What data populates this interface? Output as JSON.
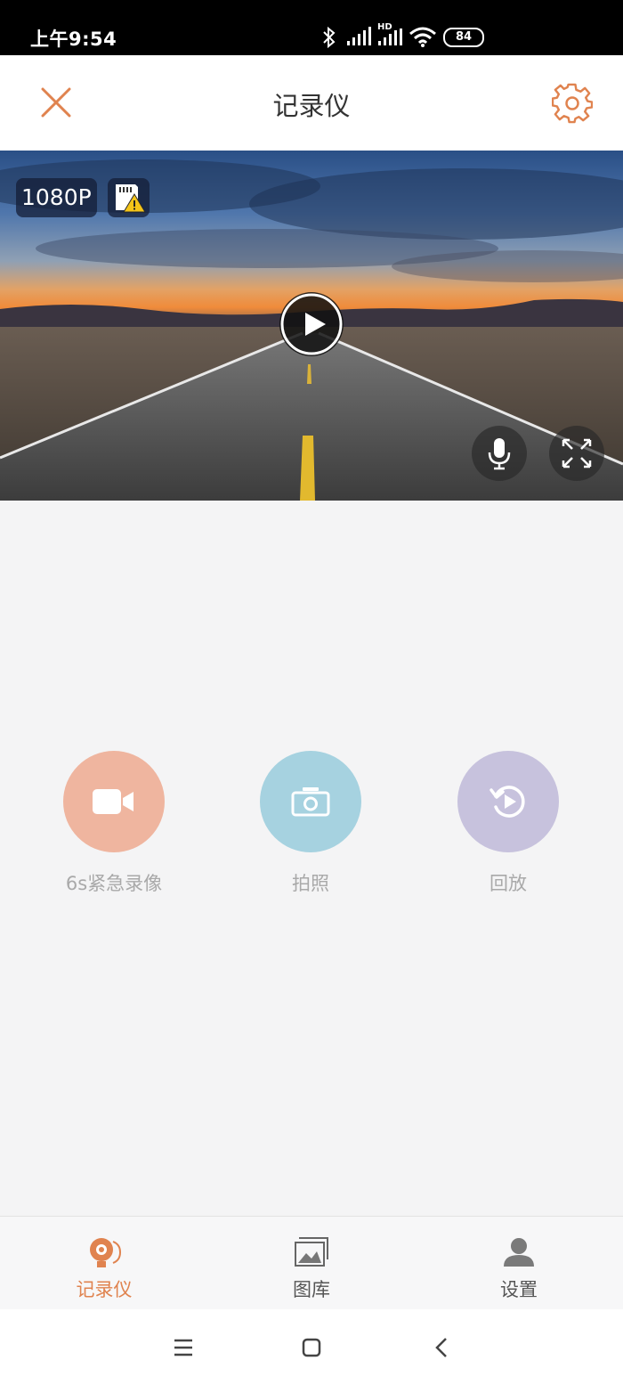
{
  "status_bar": {
    "time": "上午9:54",
    "battery": "84",
    "signal_hd": "HD"
  },
  "header": {
    "title": "记录仪"
  },
  "video": {
    "resolution": "1080P"
  },
  "actions": [
    {
      "label": "6s紧急录像",
      "color": "#efb59f"
    },
    {
      "label": "拍照",
      "color": "#a6d2e0"
    },
    {
      "label": "回放",
      "color": "#c7c2dd"
    }
  ],
  "tabs": [
    {
      "label": "记录仪",
      "active": true
    },
    {
      "label": "图库",
      "active": false
    },
    {
      "label": "设置",
      "active": false
    }
  ],
  "colors": {
    "accent": "#e0834f",
    "inactive": "#555555"
  }
}
